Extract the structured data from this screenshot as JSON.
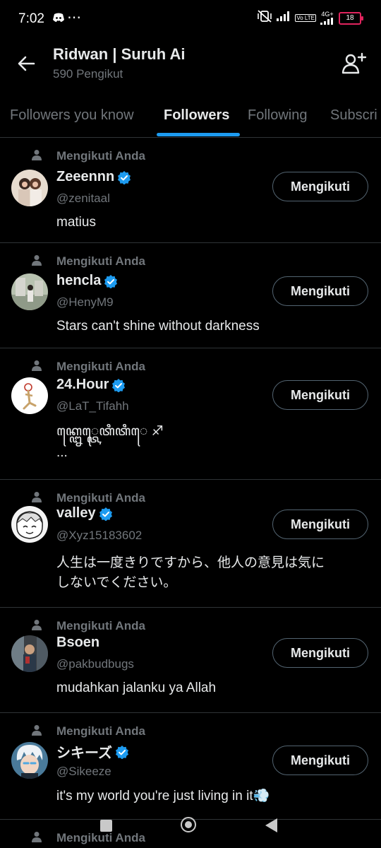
{
  "status_bar": {
    "time": "7:02",
    "more": "⋯",
    "network": "4G+",
    "lte": "Vo LTE",
    "battery": "18"
  },
  "header": {
    "title": "Ridwan | Suruh Ai",
    "subtitle": "590 Pengikut"
  },
  "tabs": [
    {
      "label": "Followers you know",
      "active": false
    },
    {
      "label": "Followers",
      "active": true
    },
    {
      "label": "Following",
      "active": false
    },
    {
      "label": "Subscri",
      "active": false
    }
  ],
  "accent_color": "#1d9bf0",
  "followers": [
    {
      "follows_you": "Mengikuti Anda",
      "name": "Zeeennn",
      "verified": true,
      "handle": "@zenitaal",
      "bio": "matius",
      "button": "Mengikuti"
    },
    {
      "follows_you": "Mengikuti Anda",
      "name": "hencla",
      "verified": true,
      "handle": "@HenyM9",
      "bio": "Stars can't shine without darkness",
      "button": "Mengikuti"
    },
    {
      "follows_you": "Mengikuti Anda",
      "name": "24.Hour",
      "verified": true,
      "handle": "@LaT_Tifahh",
      "bio": "ꦏ꧀ꦊꦺ꧀ꦠꦺꦠꦶꦠꦶꦺ ♐",
      "bio2": "...",
      "button": "Mengikuti"
    },
    {
      "follows_you": "Mengikuti Anda",
      "name": "valley",
      "verified": true,
      "handle": "@Xyz15183602",
      "bio": "人生は一度きりですから、他人の意見は気に",
      "bio2": "しないでください。",
      "button": "Mengikuti"
    },
    {
      "follows_you": "Mengikuti Anda",
      "name": "Bsoen",
      "verified": false,
      "handle": "@pakbudbugs",
      "bio": "mudahkan jalanku ya Allah",
      "button": "Mengikuti"
    },
    {
      "follows_you": "Mengikuti Anda",
      "name": "シキーズ",
      "verified": true,
      "handle": "@Sikeeze",
      "bio": "it's my world you're just living in it💨",
      "button": "Mengikuti"
    },
    {
      "follows_you": "Mengikuti Anda"
    }
  ]
}
